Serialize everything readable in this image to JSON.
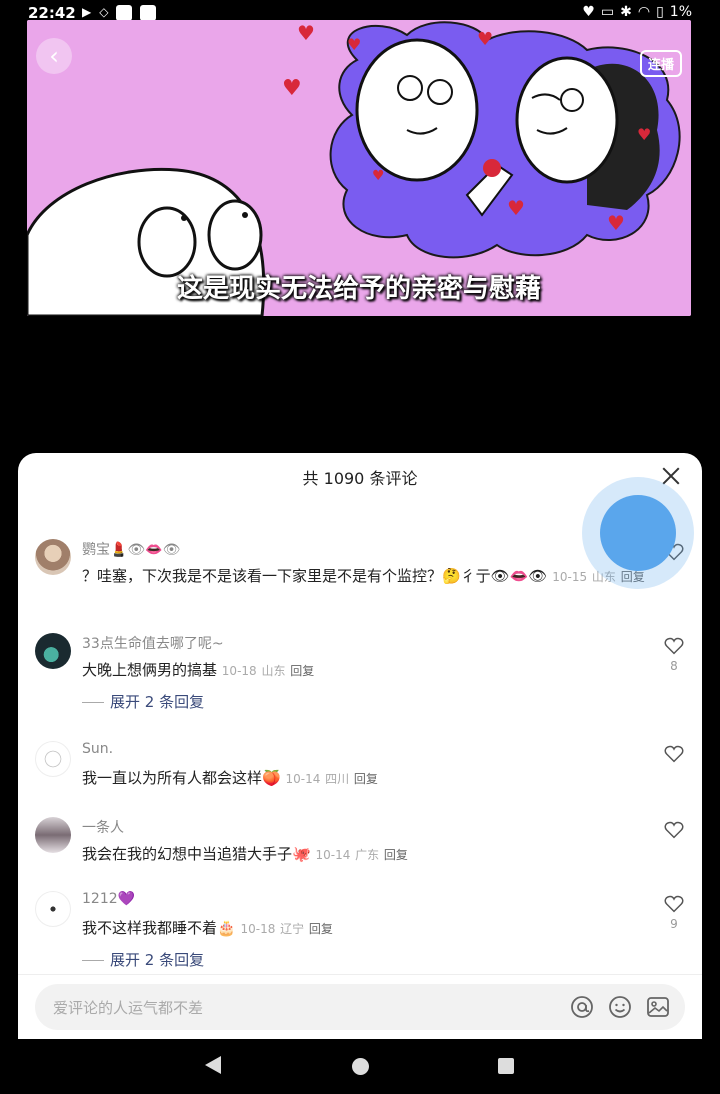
{
  "status_bar": {
    "time": "22:42",
    "battery": "1%"
  },
  "video": {
    "autoplay_label": "连播",
    "subtitle": "这是现实无法给予的亲密与慰藉"
  },
  "comments_sheet": {
    "title": "共 1090 条评论",
    "comments": [
      {
        "user": "鹦宝💄👁👄👁",
        "text": "？哇塞，下次我是不是该看一下家里是不是有个监控？🤔彳亍👁👄👁",
        "date": "10-15",
        "location": "山东",
        "reply": "回复",
        "likes": ""
      },
      {
        "user": "33点生命值去哪了呢~",
        "text": "大晚上想俩男的搞基",
        "date": "10-18",
        "location": "山东",
        "reply": "回复",
        "likes": "8",
        "expand": "展开 2 条回复"
      },
      {
        "user": "Sun.",
        "text": "我一直以为所有人都会这样🍑",
        "date": "10-14",
        "location": "四川",
        "reply": "回复",
        "likes": ""
      },
      {
        "user": "一条人",
        "text": "我会在我的幻想中当追猎大手子🐙",
        "date": "10-14",
        "location": "广东",
        "reply": "回复",
        "likes": ""
      },
      {
        "user": "1212💜",
        "text": "我不这样我都睡不着🎂",
        "date": "10-18",
        "location": "辽宁",
        "reply": "回复",
        "likes": "9",
        "expand": "展开 2 条回复"
      }
    ],
    "input_placeholder": "爱评论的人运气都不差"
  },
  "colors": {
    "video_bg": "#e8a8e8",
    "bubble": "#7a5cf0",
    "floating_ball": "#5aa6ec",
    "expand_link": "#3a4a7a"
  },
  "icons": [
    "back-icon",
    "close-icon",
    "heart-icon",
    "at-icon",
    "emoji-icon",
    "image-icon"
  ]
}
